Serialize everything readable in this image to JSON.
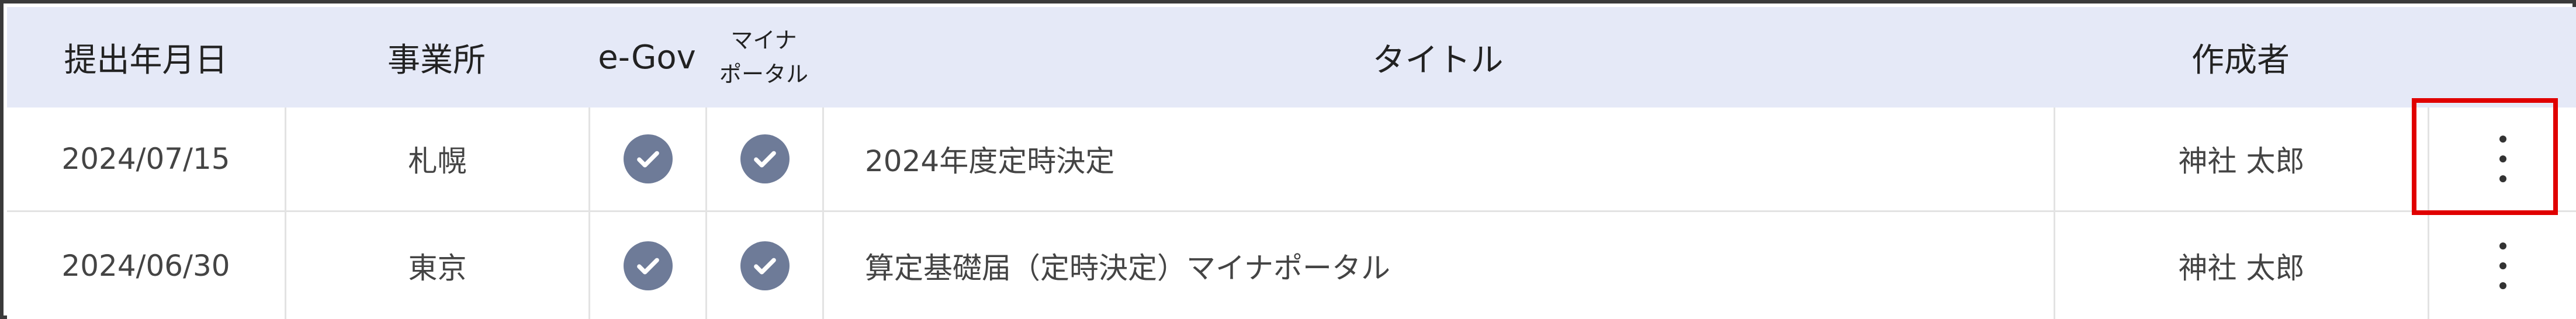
{
  "header": {
    "date": "提出年月日",
    "office": "事業所",
    "egov": "e-Gov",
    "myna_line1": "マイナ",
    "myna_line2": "ポータル",
    "title": "タイトル",
    "author": "作成者"
  },
  "rows": [
    {
      "date": "2024/07/15",
      "office": "札幌",
      "egov": "checked",
      "myna": "checked",
      "title": "2024年度定時決定",
      "author": "神社 太郎"
    },
    {
      "date": "2024/06/30",
      "office": "東京",
      "egov": "checked",
      "myna": "checked",
      "title": "算定基礎届（定時決定）マイナポータル",
      "author": "神社 太郎"
    }
  ],
  "colors": {
    "header_bg": "#e5e9f7",
    "check_bg": "#6e7b98",
    "highlight_border": "#e00000",
    "frame_border": "#3a3a3a"
  },
  "icons": {
    "status": "check-circle-icon",
    "menu": "more-vertical-icon"
  }
}
